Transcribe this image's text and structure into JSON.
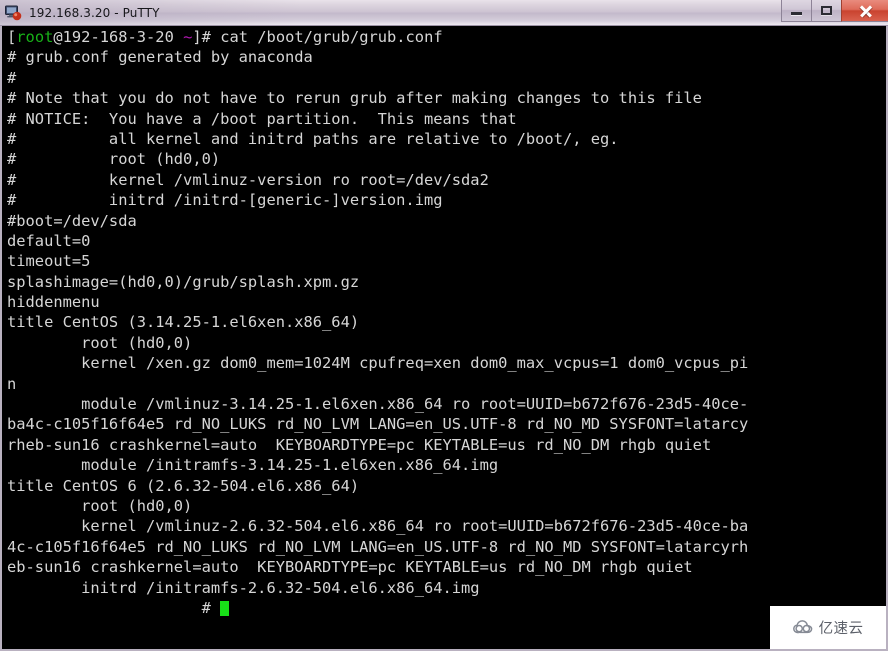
{
  "window": {
    "title": "192.168.3.20 - PuTTY",
    "icon": "putty-computer-icon",
    "controls": {
      "minimize_label": "Minimize",
      "maximize_label": "Restore",
      "close_label": "Close"
    }
  },
  "terminal": {
    "prompt": {
      "open_bracket": "[",
      "user": "root",
      "at": "@",
      "host": "192-168-3-20",
      "space": " ",
      "cwd": "~",
      "close_bracket": "]# ",
      "command": "cat /boot/grub/grub.conf"
    },
    "colors": {
      "background": "#000000",
      "foreground": "#d6d6d6",
      "user_green": "#18b218",
      "cwd_purple": "#b218b2",
      "cursor_green": "#18e018"
    },
    "output_lines": [
      "# grub.conf generated by anaconda",
      "#",
      "# Note that you do not have to rerun grub after making changes to this file",
      "# NOTICE:  You have a /boot partition.  This means that",
      "#          all kernel and initrd paths are relative to /boot/, eg.",
      "#          root (hd0,0)",
      "#          kernel /vmlinuz-version ro root=/dev/sda2",
      "#          initrd /initrd-[generic-]version.img",
      "#boot=/dev/sda",
      "default=0",
      "timeout=5",
      "splashimage=(hd0,0)/grub/splash.xpm.gz",
      "hiddenmenu",
      "title CentOS (3.14.25-1.el6xen.x86_64)",
      "        root (hd0,0)",
      "        kernel /xen.gz dom0_mem=1024M cpufreq=xen dom0_max_vcpus=1 dom0_vcpus_pi",
      "n",
      "        module /vmlinuz-3.14.25-1.el6xen.x86_64 ro root=UUID=b672f676-23d5-40ce-",
      "ba4c-c105f16f64e5 rd_NO_LUKS rd_NO_LVM LANG=en_US.UTF-8 rd_NO_MD SYSFONT=latarcy",
      "rheb-sun16 crashkernel=auto  KEYBOARDTYPE=pc KEYTABLE=us rd_NO_DM rhgb quiet",
      "        module /initramfs-3.14.25-1.el6xen.x86_64.img",
      "title CentOS 6 (2.6.32-504.el6.x86_64)",
      "        root (hd0,0)",
      "        kernel /vmlinuz-2.6.32-504.el6.x86_64 ro root=UUID=b672f676-23d5-40ce-ba",
      "4c-c105f16f64e5 rd_NO_LUKS rd_NO_LVM LANG=en_US.UTF-8 rd_NO_MD SYSFONT=latarcyrh",
      "eb-sun16 crashkernel=auto  KEYBOARDTYPE=pc KEYTABLE=us rd_NO_DM rhgb quiet",
      "        initrd /initramfs-2.6.32-504.el6.x86_64.img"
    ],
    "final_prompt": {
      "prefix": "                     # "
    }
  },
  "watermark": {
    "text": "亿速云",
    "logo": "cloud-swirl-icon"
  }
}
